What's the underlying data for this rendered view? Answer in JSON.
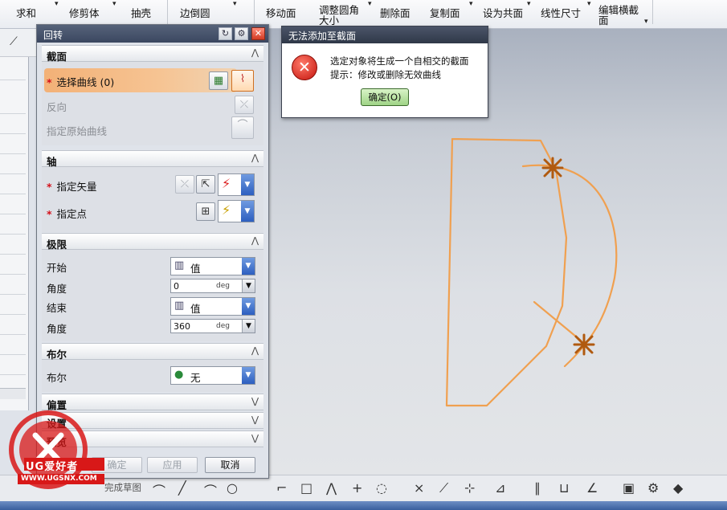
{
  "ribbon": {
    "items": [
      "求和",
      "修剪体",
      "抽壳",
      "边倒圆",
      "移动面",
      "调整圆角大小",
      "删除面",
      "复制面",
      "设为共面",
      "线性尺寸",
      "编辑横截面"
    ]
  },
  "dialog": {
    "title": "回转",
    "sections": {
      "section": {
        "title": "截面",
        "select_curve": "选择曲线 (0)",
        "reverse": "反向",
        "specify_origin_curve": "指定原始曲线"
      },
      "axis": {
        "title": "轴",
        "specify_vector": "指定矢量",
        "specify_point": "指定点"
      },
      "limits": {
        "title": "极限",
        "start_label": "开始",
        "start_value": "值",
        "start_angle_label": "角度",
        "start_angle": "0",
        "end_label": "结束",
        "end_value": "值",
        "end_angle_label": "角度",
        "end_angle": "360",
        "unit": "deg"
      },
      "boolean": {
        "title": "布尔",
        "label": "布尔",
        "value": "无"
      },
      "offset": {
        "title": "偏置"
      },
      "settings": {
        "title": "设置"
      },
      "preview": {
        "title": "预览"
      }
    },
    "buttons": {
      "ok": "确定",
      "apply": "应用",
      "cancel": "取消"
    }
  },
  "error_dialog": {
    "title": "无法添加至截面",
    "line1": "选定对象将生成一个自相交的截面",
    "line2": "提示：修改或删除无效曲线",
    "ok": "确定(O)"
  },
  "bottom_bar": {
    "finish_sketch": "完成草图"
  },
  "watermark": {
    "brand": "UG爱好者",
    "url": "WWW.UGSNX.COM"
  },
  "colors": {
    "curve": "#f0a050",
    "accent": "#f3b177",
    "marker": "#b05a10",
    "error": "#c4140c"
  }
}
